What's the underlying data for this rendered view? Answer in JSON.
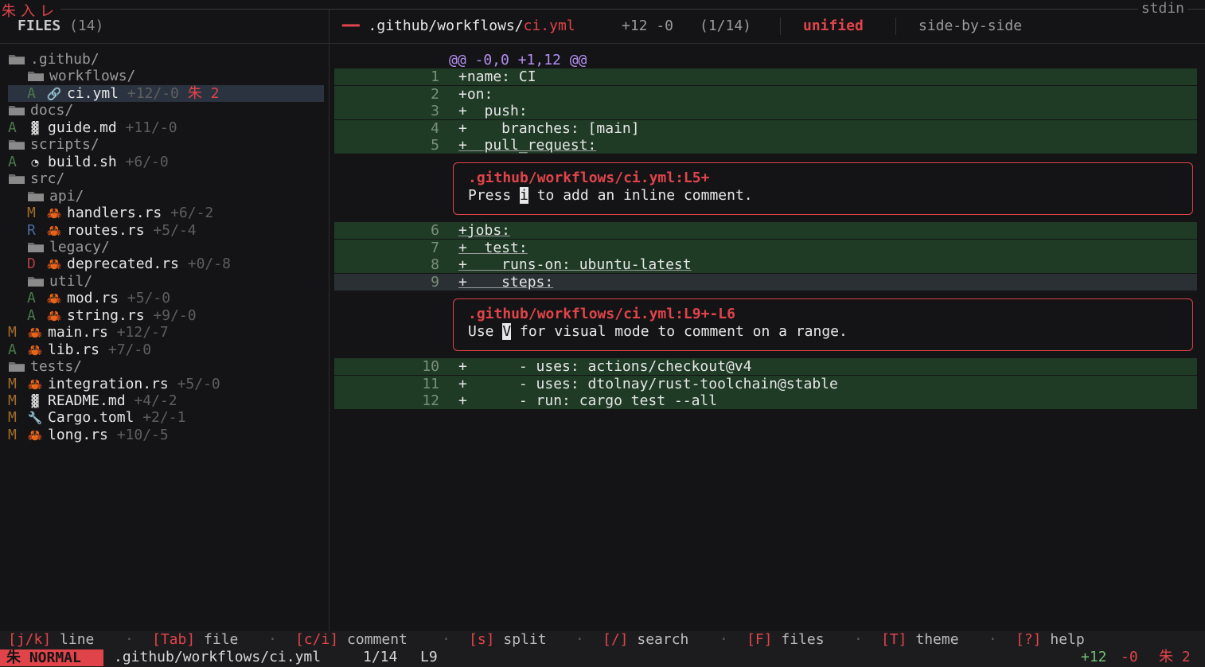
{
  "app": {
    "brand": "朱入レ",
    "source": "stdin"
  },
  "sidebar": {
    "title": "FILES",
    "count": "(14)",
    "tree": [
      {
        "kind": "dir",
        "name": ".github/",
        "depth": 0
      },
      {
        "kind": "dir",
        "name": "workflows/",
        "depth": 1
      },
      {
        "kind": "file",
        "status": "A",
        "icon": "link-icon",
        "glyph": "🔗",
        "name": "ci.yml",
        "stats": "+12/-0",
        "comments": "朱 2",
        "depth": 2,
        "selected": true
      },
      {
        "kind": "dir",
        "name": "docs/",
        "depth": 0
      },
      {
        "kind": "file",
        "status": "A",
        "icon": "document-icon",
        "glyph": "▓",
        "name": "guide.md",
        "stats": "+11/-0",
        "depth": 1
      },
      {
        "kind": "dir",
        "name": "scripts/",
        "depth": 0
      },
      {
        "kind": "file",
        "status": "A",
        "icon": "shell-icon",
        "glyph": "◔",
        "name": "build.sh",
        "stats": "+6/-0",
        "depth": 1
      },
      {
        "kind": "dir",
        "name": "src/",
        "depth": 0
      },
      {
        "kind": "dir",
        "name": "api/",
        "depth": 1
      },
      {
        "kind": "file",
        "status": "M",
        "icon": "crab-icon",
        "glyph": "🦀",
        "name": "handlers.rs",
        "stats": "+6/-2",
        "depth": 2
      },
      {
        "kind": "file",
        "status": "R",
        "icon": "crab-icon",
        "glyph": "🦀",
        "name": "routes.rs",
        "stats": "+5/-4",
        "depth": 2
      },
      {
        "kind": "dir",
        "name": "legacy/",
        "depth": 1
      },
      {
        "kind": "file",
        "status": "D",
        "icon": "crab-icon",
        "glyph": "🦀",
        "name": "deprecated.rs",
        "stats": "+0/-8",
        "depth": 2
      },
      {
        "kind": "dir",
        "name": "util/",
        "depth": 1
      },
      {
        "kind": "file",
        "status": "A",
        "icon": "crab-icon",
        "glyph": "🦀",
        "name": "mod.rs",
        "stats": "+5/-0",
        "depth": 2
      },
      {
        "kind": "file",
        "status": "A",
        "icon": "crab-icon",
        "glyph": "🦀",
        "name": "string.rs",
        "stats": "+9/-0",
        "depth": 2
      },
      {
        "kind": "file",
        "status": "M",
        "icon": "crab-icon",
        "glyph": "🦀",
        "name": "main.rs",
        "stats": "+12/-7",
        "depth": 1
      },
      {
        "kind": "file",
        "status": "A",
        "icon": "crab-icon",
        "glyph": "🦀",
        "name": "lib.rs",
        "stats": "+7/-0",
        "depth": 1
      },
      {
        "kind": "dir",
        "name": "tests/",
        "depth": 0
      },
      {
        "kind": "file",
        "status": "M",
        "icon": "crab-icon",
        "glyph": "🦀",
        "name": "integration.rs",
        "stats": "+5/-0",
        "depth": 1
      },
      {
        "kind": "file",
        "status": "M",
        "icon": "document-icon",
        "glyph": "▓",
        "name": "README.md",
        "stats": "+4/-2",
        "depth": 0
      },
      {
        "kind": "file",
        "status": "M",
        "icon": "wrench-icon",
        "glyph": "🔧",
        "name": "Cargo.toml",
        "stats": "+2/-1",
        "depth": 0
      },
      {
        "kind": "file",
        "status": "M",
        "icon": "crab-icon",
        "glyph": "🦀",
        "name": "long.rs",
        "stats": "+10/-5",
        "depth": 0
      }
    ]
  },
  "diff_header": {
    "marker": "━━",
    "path_dir": ".github/workflows/",
    "path_file": "ci.yml",
    "stats": "+12 -0",
    "position": "(1/14)",
    "mode_unified": "unified",
    "mode_side": "side-by-side"
  },
  "diff": {
    "hunk": "@@ -0,0 +1,12 @@",
    "lines_a": [
      {
        "no": "1",
        "text": "+name: CI"
      },
      {
        "no": "2",
        "text": "+on:"
      },
      {
        "no": "3",
        "text": "+  push:"
      },
      {
        "no": "4",
        "text": "+    branches: [main]"
      },
      {
        "no": "5",
        "text": "+  pull_request:"
      }
    ],
    "comment1": {
      "ref": ".github/workflows/ci.yml:L5+",
      "pre": "Press ",
      "key": "i",
      "post": " to add an inline comment."
    },
    "lines_b": [
      {
        "no": "6",
        "text": "+jobs:"
      },
      {
        "no": "7",
        "text": "+  test:"
      },
      {
        "no": "8",
        "text": "+    runs-on: ubuntu-latest"
      },
      {
        "no": "9",
        "text": "+    steps:"
      }
    ],
    "comment2": {
      "ref": ".github/workflows/ci.yml:L9+-L6",
      "pre": "Use ",
      "key": "V",
      "post": " for visual mode to comment on a range."
    },
    "lines_c": [
      {
        "no": "10",
        "text": "+      - uses: actions/checkout@v4"
      },
      {
        "no": "11",
        "text": "+      - uses: dtolnay/rust-toolchain@stable"
      },
      {
        "no": "12",
        "text": "+      - run: cargo test --all"
      }
    ]
  },
  "keyhints": [
    {
      "key": "[j/k]",
      "desc": "line"
    },
    {
      "key": "[Tab]",
      "desc": "file"
    },
    {
      "key": "[c/i]",
      "desc": "comment"
    },
    {
      "key": "[s]",
      "desc": "split"
    },
    {
      "key": "[/]",
      "desc": "search"
    },
    {
      "key": "[F]",
      "desc": "files"
    },
    {
      "key": "[T]",
      "desc": "theme"
    },
    {
      "key": "[?]",
      "desc": "help"
    }
  ],
  "status": {
    "mode": "朱 NORMAL",
    "path": ".github/workflows/ci.yml",
    "position": "1/14",
    "line": "L9",
    "added": "+12",
    "removed": "-0",
    "comments": "朱 2"
  },
  "colors": {
    "accent": "#e0444a",
    "add_bg": "#1f3b26",
    "selection": "#2c3340"
  }
}
